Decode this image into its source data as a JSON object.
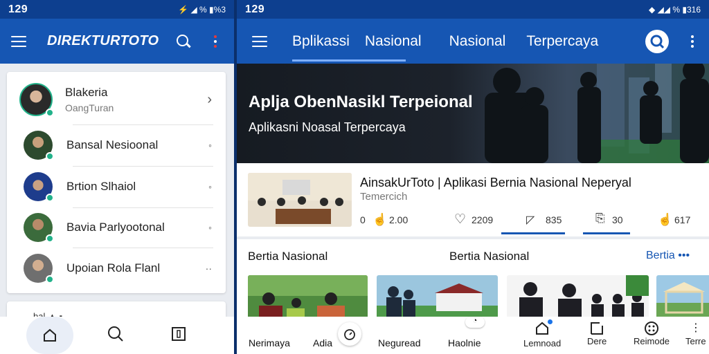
{
  "left": {
    "status": {
      "time": "129",
      "icons": "⚡ ◢ % ▮%3"
    },
    "appbar": {
      "brand": "DIREKTURTOTO"
    },
    "list": [
      {
        "name": "Blakeria",
        "sub": "OangTuran",
        "chevron": "›"
      },
      {
        "name": "Bansal Nesioonal",
        "chevron": "◦"
      },
      {
        "name": "Brtion Slhaiol",
        "chevron": "◦"
      },
      {
        "name": "Bavia Parlyootonal",
        "chevron": "◦"
      },
      {
        "name": "Upoian Rola Flanl",
        "chevron": "··"
      }
    ],
    "peek": "bal ▲ ▪",
    "bottom_icons": [
      "home-icon",
      "search-icon",
      "bookmark-icon"
    ]
  },
  "right": {
    "status": {
      "time": "129",
      "icons": "◆ ◢◢ % ▮316"
    },
    "tabs": [
      "Bplikassi",
      "Nasional",
      "Nasional",
      "Terpercaya"
    ],
    "hero": {
      "title": "Aplja ObenNasikl Terpeional",
      "subtitle": "Aplikasni Noasal Terpercaya"
    },
    "article": {
      "title": "AinsakUrToto | Aplikasi Bernia Nasional Neperyal",
      "meta": "Temercich",
      "stats": [
        {
          "icon": "thumb-up-icon",
          "prefix": "0",
          "value": "2.00"
        },
        {
          "icon": "heart-icon",
          "value": "2209"
        },
        {
          "icon": "comment-icon",
          "value": "835"
        },
        {
          "icon": "share-icon",
          "value": "30"
        },
        {
          "icon": "like-icon",
          "value": "617"
        }
      ]
    },
    "section": {
      "left_title": "Bertia Nasional",
      "mid_title": "Bertia Nasional",
      "more": "Bertia"
    },
    "news": [
      {
        "label": "Nerimaya",
        "label2": "Adia"
      },
      {
        "label": "Neguread",
        "label2": "Haolnie"
      },
      {
        "label": ""
      },
      {
        "label": ""
      }
    ],
    "bottom_nav": [
      "Lemnoad",
      "Dere",
      "Reimode",
      "Terre"
    ]
  }
}
